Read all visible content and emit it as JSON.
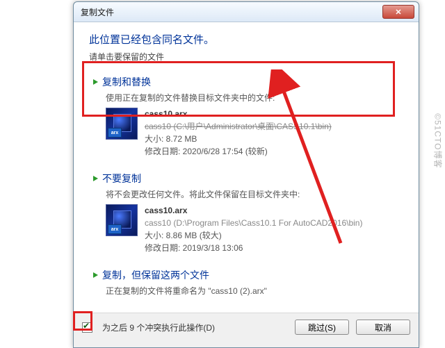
{
  "titlebar": {
    "title": "复制文件",
    "close": "✕"
  },
  "heading": "此位置已经包含同名文件。",
  "subheading": "请单击要保留的文件",
  "options": {
    "replace": {
      "title": "复制和替换",
      "desc": "使用正在复制的文件替换目标文件夹中的文件:",
      "file": {
        "name": "cass10.arx",
        "path": "cass10 (C:\\用户\\Administrator\\桌面\\CASS10.1\\bin)",
        "size_label": "大小: 8.72 MB",
        "date_label": "修改日期: 2020/6/28 17:54 (较新)",
        "badge": "arx"
      }
    },
    "skip": {
      "title": "不要复制",
      "desc": "将不会更改任何文件。将此文件保留在目标文件夹中:",
      "file": {
        "name": "cass10.arx",
        "path": "cass10 (D:\\Program Files\\Cass10.1 For AutoCAD2016\\bin)",
        "size_label": "大小: 8.86 MB (较大)",
        "date_label": "修改日期: 2019/3/18 13:06",
        "badge": "arx"
      }
    },
    "keepboth": {
      "title": "复制，但保留这两个文件",
      "desc": "正在复制的文件将重命名为 \"cass10 (2).arx\""
    }
  },
  "footer": {
    "checkbox_checked": true,
    "count_prefix": "为之后 ",
    "count": 9,
    "count_suffix": " 个冲突执行此操作(D)",
    "skip_btn": "跳过(S)",
    "cancel_btn": "取消"
  },
  "watermark": "©51CTO博客"
}
